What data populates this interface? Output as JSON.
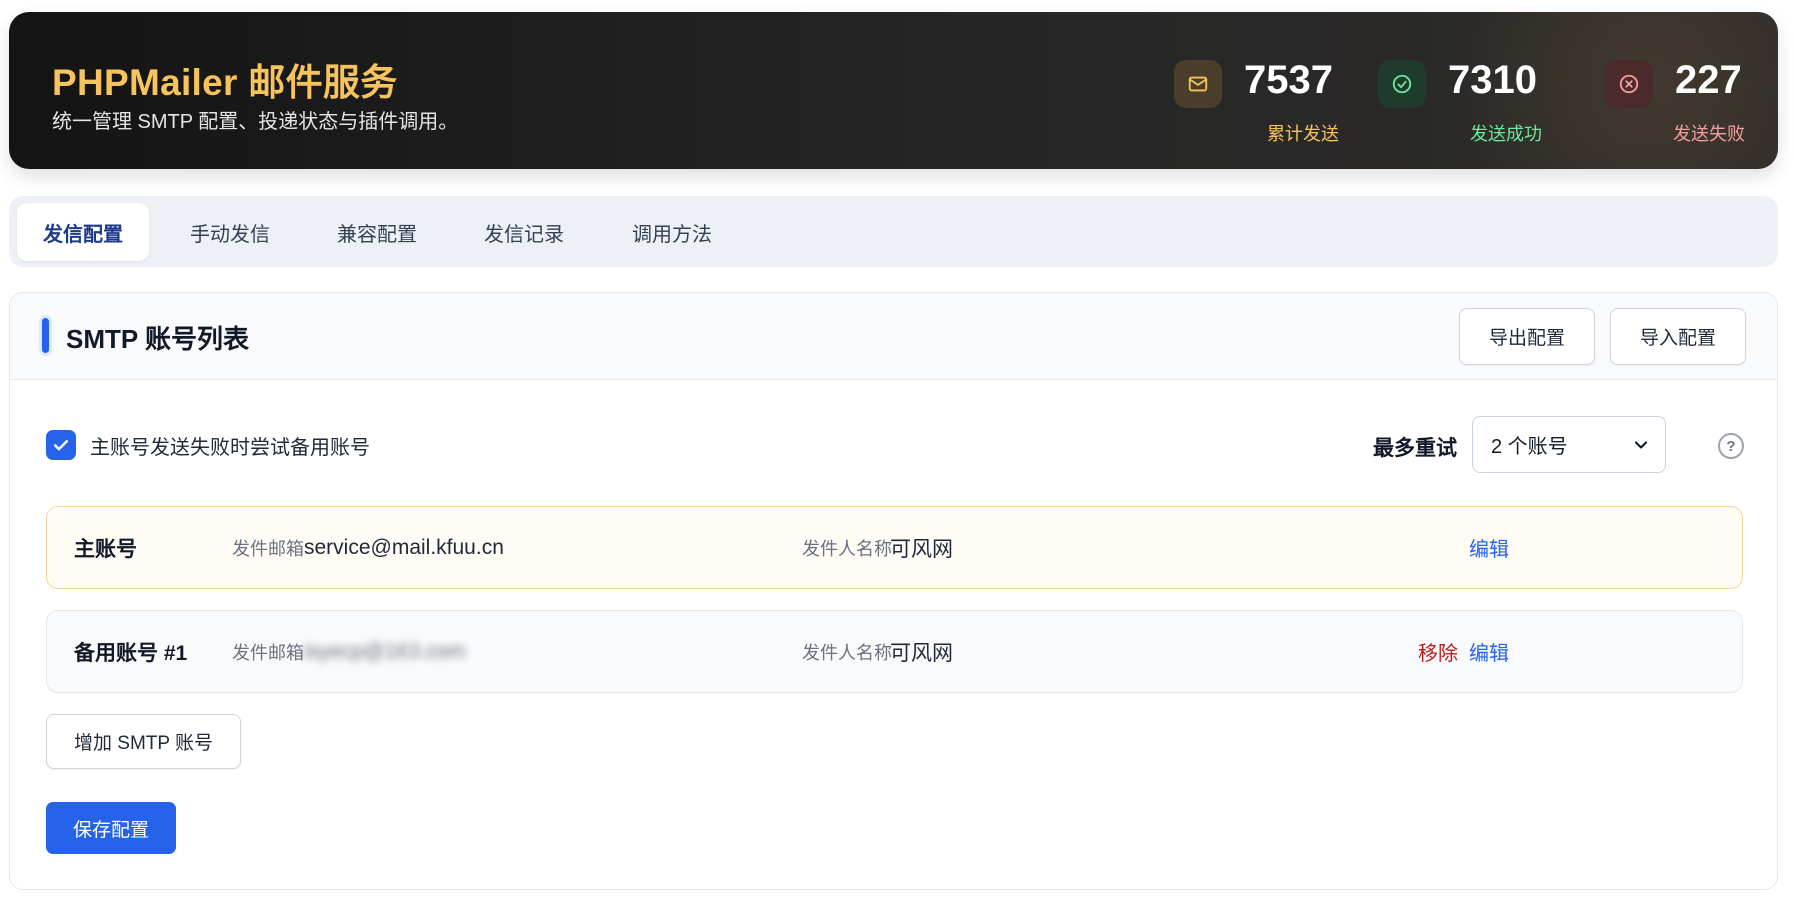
{
  "header": {
    "title": "PHPMailer 邮件服务",
    "subtitle": "统一管理 SMTP 配置、投递状态与插件调用。",
    "stats": {
      "total": {
        "value": "7537",
        "label": "累计发送",
        "icon": "mail-icon",
        "color": "#f6c35c"
      },
      "success": {
        "value": "7310",
        "label": "发送成功",
        "icon": "check-circle-icon",
        "color": "#6ee7a0"
      },
      "failed": {
        "value": "227",
        "label": "发送失败",
        "icon": "x-circle-icon",
        "color": "#f59e9e"
      }
    }
  },
  "tabs": [
    {
      "label": "发信配置",
      "active": true
    },
    {
      "label": "手动发信",
      "active": false
    },
    {
      "label": "兼容配置",
      "active": false
    },
    {
      "label": "发信记录",
      "active": false
    },
    {
      "label": "调用方法",
      "active": false
    }
  ],
  "panel": {
    "title": "SMTP 账号列表",
    "export_label": "导出配置",
    "import_label": "导入配置",
    "failover": {
      "checked": true,
      "label": "主账号发送失败时尝试备用账号"
    },
    "retry": {
      "label": "最多重试",
      "selected": "2 个账号",
      "help": "?"
    },
    "accounts": [
      {
        "name": "主账号",
        "email_key": "发件邮箱",
        "email": "service@mail.kfuu.cn",
        "sender_key": "发件人名称",
        "sender": "可风网",
        "edit": "编辑"
      },
      {
        "name": "备用账号 #1",
        "email_key": "发件邮箱",
        "email": "isyecp@163.com",
        "sender_key": "发件人名称",
        "sender": "可风网",
        "remove": "移除",
        "edit": "编辑"
      }
    ],
    "add_label": "增加 SMTP 账号",
    "save_label": "保存配置"
  },
  "colors": {
    "accent": "#2563eb",
    "brand_gold": "#f6c35c",
    "danger": "#b91c1c"
  }
}
